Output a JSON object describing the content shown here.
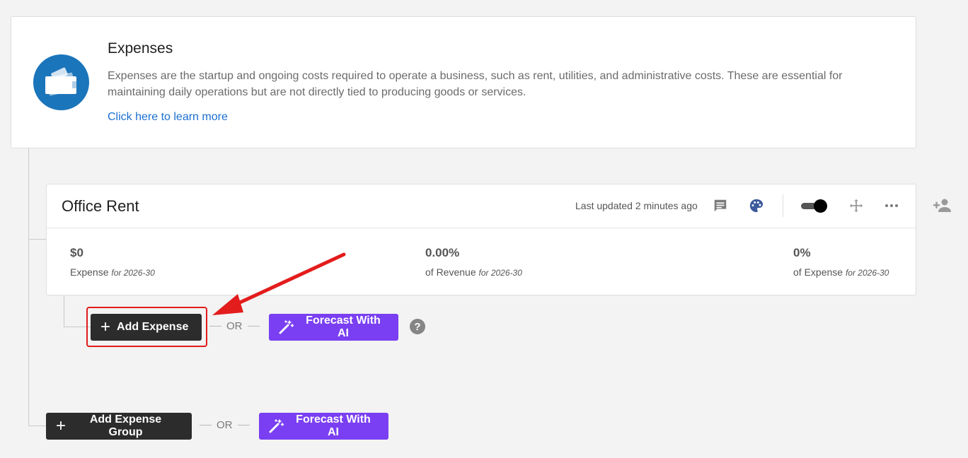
{
  "intro": {
    "title": "Expenses",
    "description": "Expenses are the startup and ongoing costs required to operate a business, such as rent, utilities, and administrative costs. These are essential for maintaining daily operations but are not directly tied to producing goods or services.",
    "learn_more": "Click here to learn more",
    "icon": "wallet-icon"
  },
  "item": {
    "title": "Office Rent",
    "last_updated": "Last updated 2 minutes ago",
    "icons": [
      "comment-icon",
      "palette-icon",
      "toggle-switch",
      "move-icon",
      "more-icon"
    ],
    "metrics": [
      {
        "value": "$0",
        "label": "Expense",
        "period": "for 2026-30"
      },
      {
        "value": "0.00%",
        "label": "of Revenue",
        "period": "for 2026-30"
      },
      {
        "value": "0%",
        "label": "of Expense",
        "period": "for 2026-30"
      }
    ]
  },
  "actions": {
    "add_expense": "Add Expense",
    "or": "OR",
    "forecast_ai": "Forecast With AI",
    "help": "?",
    "add_expense_group": "Add Expense Group"
  },
  "colors": {
    "accent_blue": "#1b75bb",
    "link": "#1a6fd0",
    "dark_button": "#2c2c2c",
    "ai_button": "#7a3ff2",
    "highlight": "#e31c1c"
  }
}
